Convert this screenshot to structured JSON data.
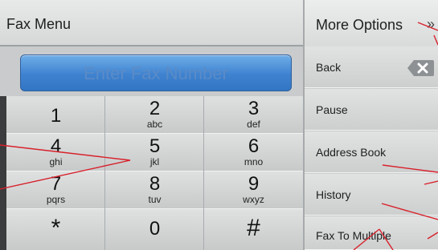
{
  "header": {
    "title": "Fax Menu",
    "more_options_label": "More Options"
  },
  "fax_field": {
    "placeholder": "Enter Fax Number"
  },
  "keypad": {
    "keys": [
      {
        "digit": "1",
        "letters": ""
      },
      {
        "digit": "2",
        "letters": "abc"
      },
      {
        "digit": "3",
        "letters": "def"
      },
      {
        "digit": "4",
        "letters": "ghi"
      },
      {
        "digit": "5",
        "letters": "jkl"
      },
      {
        "digit": "6",
        "letters": "mno"
      },
      {
        "digit": "7",
        "letters": "pqrs"
      },
      {
        "digit": "8",
        "letters": "tuv"
      },
      {
        "digit": "9",
        "letters": "wxyz"
      },
      {
        "digit": "*",
        "letters": ""
      },
      {
        "digit": "0",
        "letters": ""
      },
      {
        "digit": "#",
        "letters": ""
      }
    ]
  },
  "side_menu": {
    "items": [
      {
        "label": "Back",
        "icon": "backspace-icon"
      },
      {
        "label": "Pause"
      },
      {
        "label": "Address Book"
      },
      {
        "label": "History"
      },
      {
        "label": "Fax To Multiple"
      }
    ]
  },
  "colors": {
    "field_blue": "#3f82cf",
    "annotation_red": "#d8202a",
    "panel_gray": "#d6d8d8"
  }
}
